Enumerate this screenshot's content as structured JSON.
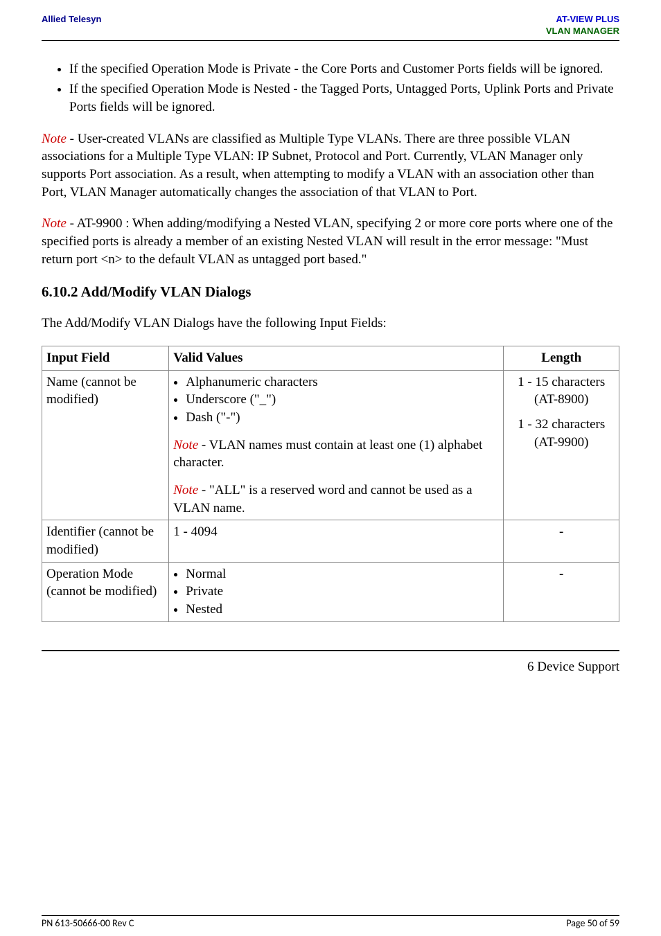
{
  "header": {
    "left": "Allied Telesyn",
    "rightLine1": "AT-VIEW PLUS",
    "rightLine2": "VLAN MANAGER"
  },
  "bullets_top": [
    "If the specified Operation Mode is Private - the Core Ports and Customer Ports fields will be ignored.",
    "If the specified Operation Mode is Nested - the Tagged Ports, Untagged Ports, Uplink Ports and Private Ports fields will be ignored."
  ],
  "note1_body": " - User-created VLANs are classified as Multiple Type VLANs. There are three possible VLAN associations for a Multiple Type VLAN: IP Subnet, Protocol and Port. Currently, VLAN Manager only supports Port association. As a result, when attempting to modify a VLAN with an association other than Port, VLAN Manager automatically changes the association of that VLAN to Port.",
  "note2_body": " - AT-9900 : When adding/modifying a Nested VLAN, specifying 2 or more core ports where one of the specified ports is already a member of an existing Nested VLAN will result in the error message: \"Must return port <n> to the default VLAN as untagged port based.\"",
  "section_heading": "6.10.2 Add/Modify VLAN Dialogs",
  "section_intro": "The Add/Modify VLAN Dialogs have the following Input Fields:",
  "table": {
    "head": {
      "c1": "Input Field",
      "c2": "Valid Values",
      "c3": "Length"
    },
    "row1": {
      "field": "Name (cannot be modified)",
      "bullets": [
        "Alphanumeric characters",
        "Underscore (\"_\")",
        "Dash (\"-\")"
      ],
      "note1_body": " - VLAN names must contain at least one (1) alphabet character.",
      "note2_body": " - \"ALL\" is a reserved word and cannot be used as a VLAN name.",
      "length_l1": "1 - 15 characters",
      "length_l2": "(AT-8900)",
      "length_l3": "1 - 32 characters",
      "length_l4": "(AT-9900)"
    },
    "row2": {
      "field": "Identifier (cannot be modified)",
      "values": "1 - 4094",
      "length": "-"
    },
    "row3": {
      "field": "Operation Mode (cannot be modified)",
      "bullets": [
        "Normal",
        "Private",
        "Nested"
      ],
      "length": "-"
    }
  },
  "right_link": "6 Device Support",
  "footer": {
    "left": "PN 613-50666-00 Rev C",
    "right": "Page 50 of 59"
  },
  "note_label": "Note"
}
